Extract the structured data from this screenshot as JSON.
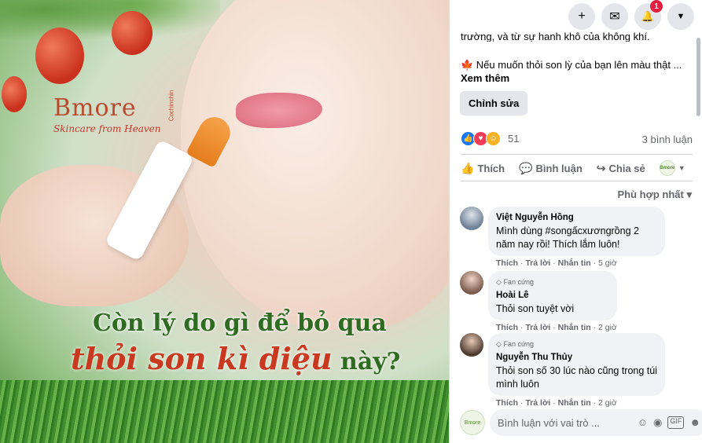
{
  "photo": {
    "brand": {
      "name": "more",
      "prefix": "B",
      "tagline": "Skincare from Heaven",
      "side": "Cochinchin"
    },
    "headline_line1": "Còn lý do gì để bỏ qua",
    "headline_line2_main": "thỏi son kì diệu",
    "headline_line2_tail": " này?"
  },
  "top_buttons": {
    "plus": "+",
    "messenger": "✉",
    "notifications": "🔔",
    "notif_badge": "1",
    "menu": "▼"
  },
  "post": {
    "caption_cut": "trường, và từ sự hanh khô của không khí.",
    "caption_line": "🍁 Nếu muốn thỏi son lỳ của bạn lên màu thật ...",
    "see_more": "Xem thêm",
    "edit_button": "Chỉnh sửa",
    "reaction_count": "51",
    "comment_count": "3 bình luận",
    "actions": {
      "like": "Thích",
      "comment": "Bình luận",
      "share": "Chia sẻ"
    },
    "sort_label": "Phù hợp nhất ▾"
  },
  "comments": [
    {
      "badge": "",
      "name": "Việt Nguyễn Hồng",
      "text": "Mình dùng #songấcxươngrồng 2 năm nay rồi! Thích lắm luôn!",
      "like": "Thích",
      "reply": "Trả lời",
      "send": "Nhắn tin",
      "time": "5 giờ"
    },
    {
      "badge": "Fan cứng",
      "name": "Hoài Lê",
      "text": "Thỏi son tuyệt vời",
      "like": "Thích",
      "reply": "Trả lời",
      "send": "Nhắn tin",
      "time": "2 giờ"
    },
    {
      "badge": "Fan cứng",
      "name": "Nguyễn Thu Thủy",
      "text": "Thỏi son số 30 lúc nào cũng trong túi mình luôn",
      "like": "Thích",
      "reply": "Trả lời",
      "send": "Nhắn tin",
      "time": "2 giờ"
    }
  ],
  "comment_input": {
    "placeholder": "Bình luận với vai trò ..."
  },
  "colors": {
    "fb_blue": "#1877f2",
    "love_red": "#f33e58",
    "wow_yellow": "#f7b125"
  }
}
